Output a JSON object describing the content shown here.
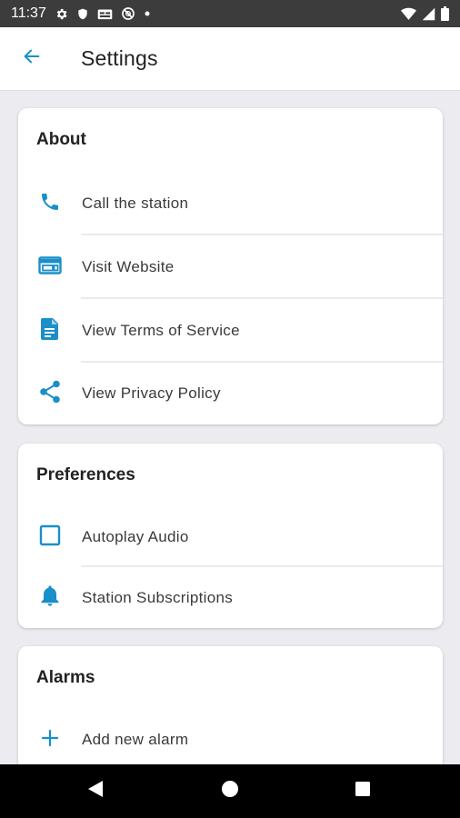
{
  "status_bar": {
    "time": "11:37",
    "icons": [
      "settings-icon",
      "shield-icon",
      "sim-card-icon",
      "data-saver-icon",
      "notification-dot-icon",
      "wifi-icon",
      "signal-icon",
      "battery-icon"
    ]
  },
  "app_bar": {
    "title": "Settings",
    "back_icon": "arrow-back-icon"
  },
  "colors": {
    "accent": "#1a8fc9",
    "background": "#ebebf0",
    "card": "#ffffff",
    "status_bar": "#3c3c3c",
    "nav_bar": "#000000"
  },
  "sections": [
    {
      "title": "About",
      "items": [
        {
          "label": "Call the station",
          "icon": "phone-icon"
        },
        {
          "label": "Visit Website",
          "icon": "web-icon"
        },
        {
          "label": "View Terms of Service",
          "icon": "document-icon"
        },
        {
          "label": "View Privacy Policy",
          "icon": "share-icon"
        }
      ]
    },
    {
      "title": "Preferences",
      "items": [
        {
          "label": "Autoplay Audio",
          "icon": "checkbox-icon",
          "checked": false
        },
        {
          "label": "Station Subscriptions",
          "icon": "bell-icon"
        }
      ]
    },
    {
      "title": "Alarms",
      "items": [
        {
          "label": "Add new alarm",
          "icon": "plus-icon"
        }
      ]
    }
  ],
  "nav_bar": {
    "buttons": [
      "back-triangle-icon",
      "home-circle-icon",
      "recents-square-icon"
    ]
  }
}
